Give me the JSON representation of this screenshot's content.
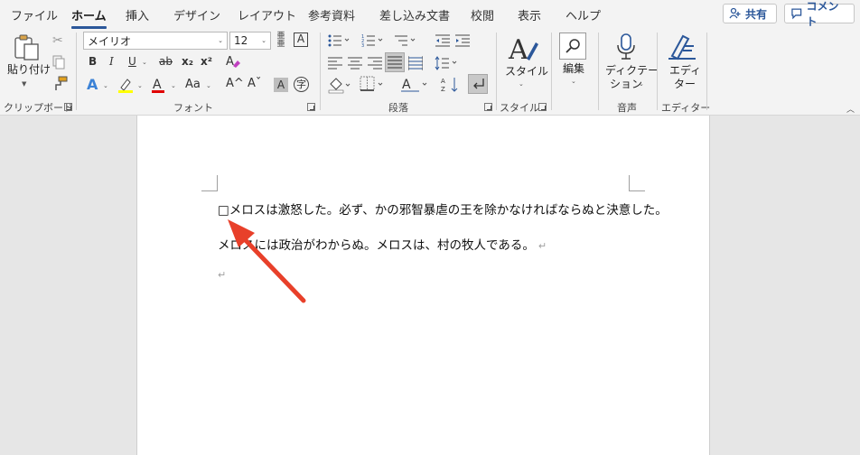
{
  "tabs": [
    "ファイル",
    "ホーム",
    "挿入",
    "デザイン",
    "レイアウト",
    "参考資料",
    "差し込み文書",
    "校閲",
    "表示",
    "ヘルプ"
  ],
  "active_tab": "ホーム",
  "share_button": "共有",
  "comment_button": "コメント",
  "clipboard": {
    "paste_label_1": "貼り付け",
    "group_label": "クリップボード"
  },
  "font": {
    "name": "メイリオ",
    "size": "12",
    "group_label": "フォント",
    "buttons": {
      "bold": "B",
      "italic": "I",
      "underline": "U",
      "strike": "ab",
      "sub": "x₂",
      "sup": "x²",
      "text_effect": "A",
      "change_case": "Aa",
      "grow": "A^",
      "shrink": "Aˇ",
      "char_shading": "A",
      "enclose": "字"
    }
  },
  "paragraph": {
    "group_label": "段落"
  },
  "styles": {
    "label": "スタイル",
    "group_label": "スタイル"
  },
  "editing": {
    "label": "編集"
  },
  "voice": {
    "label_1": "ディクテー",
    "label_2": "ション",
    "group_label": "音声"
  },
  "editor": {
    "label_1": "エディ",
    "label_2": "ター",
    "group_label": "エディター"
  },
  "document": {
    "line1": "□メロスは激怒した。必ず、かの邪智暴虐の王を除かなければならぬと決意した。",
    "line2": "メロスには政治がわからぬ。メロスは、村の牧人である。",
    "para_mark": "↵"
  },
  "colors": {
    "accent": "#2b579a",
    "arrow": "#e8402a",
    "highlight": "#ffff00",
    "font_color": "#e00000"
  }
}
